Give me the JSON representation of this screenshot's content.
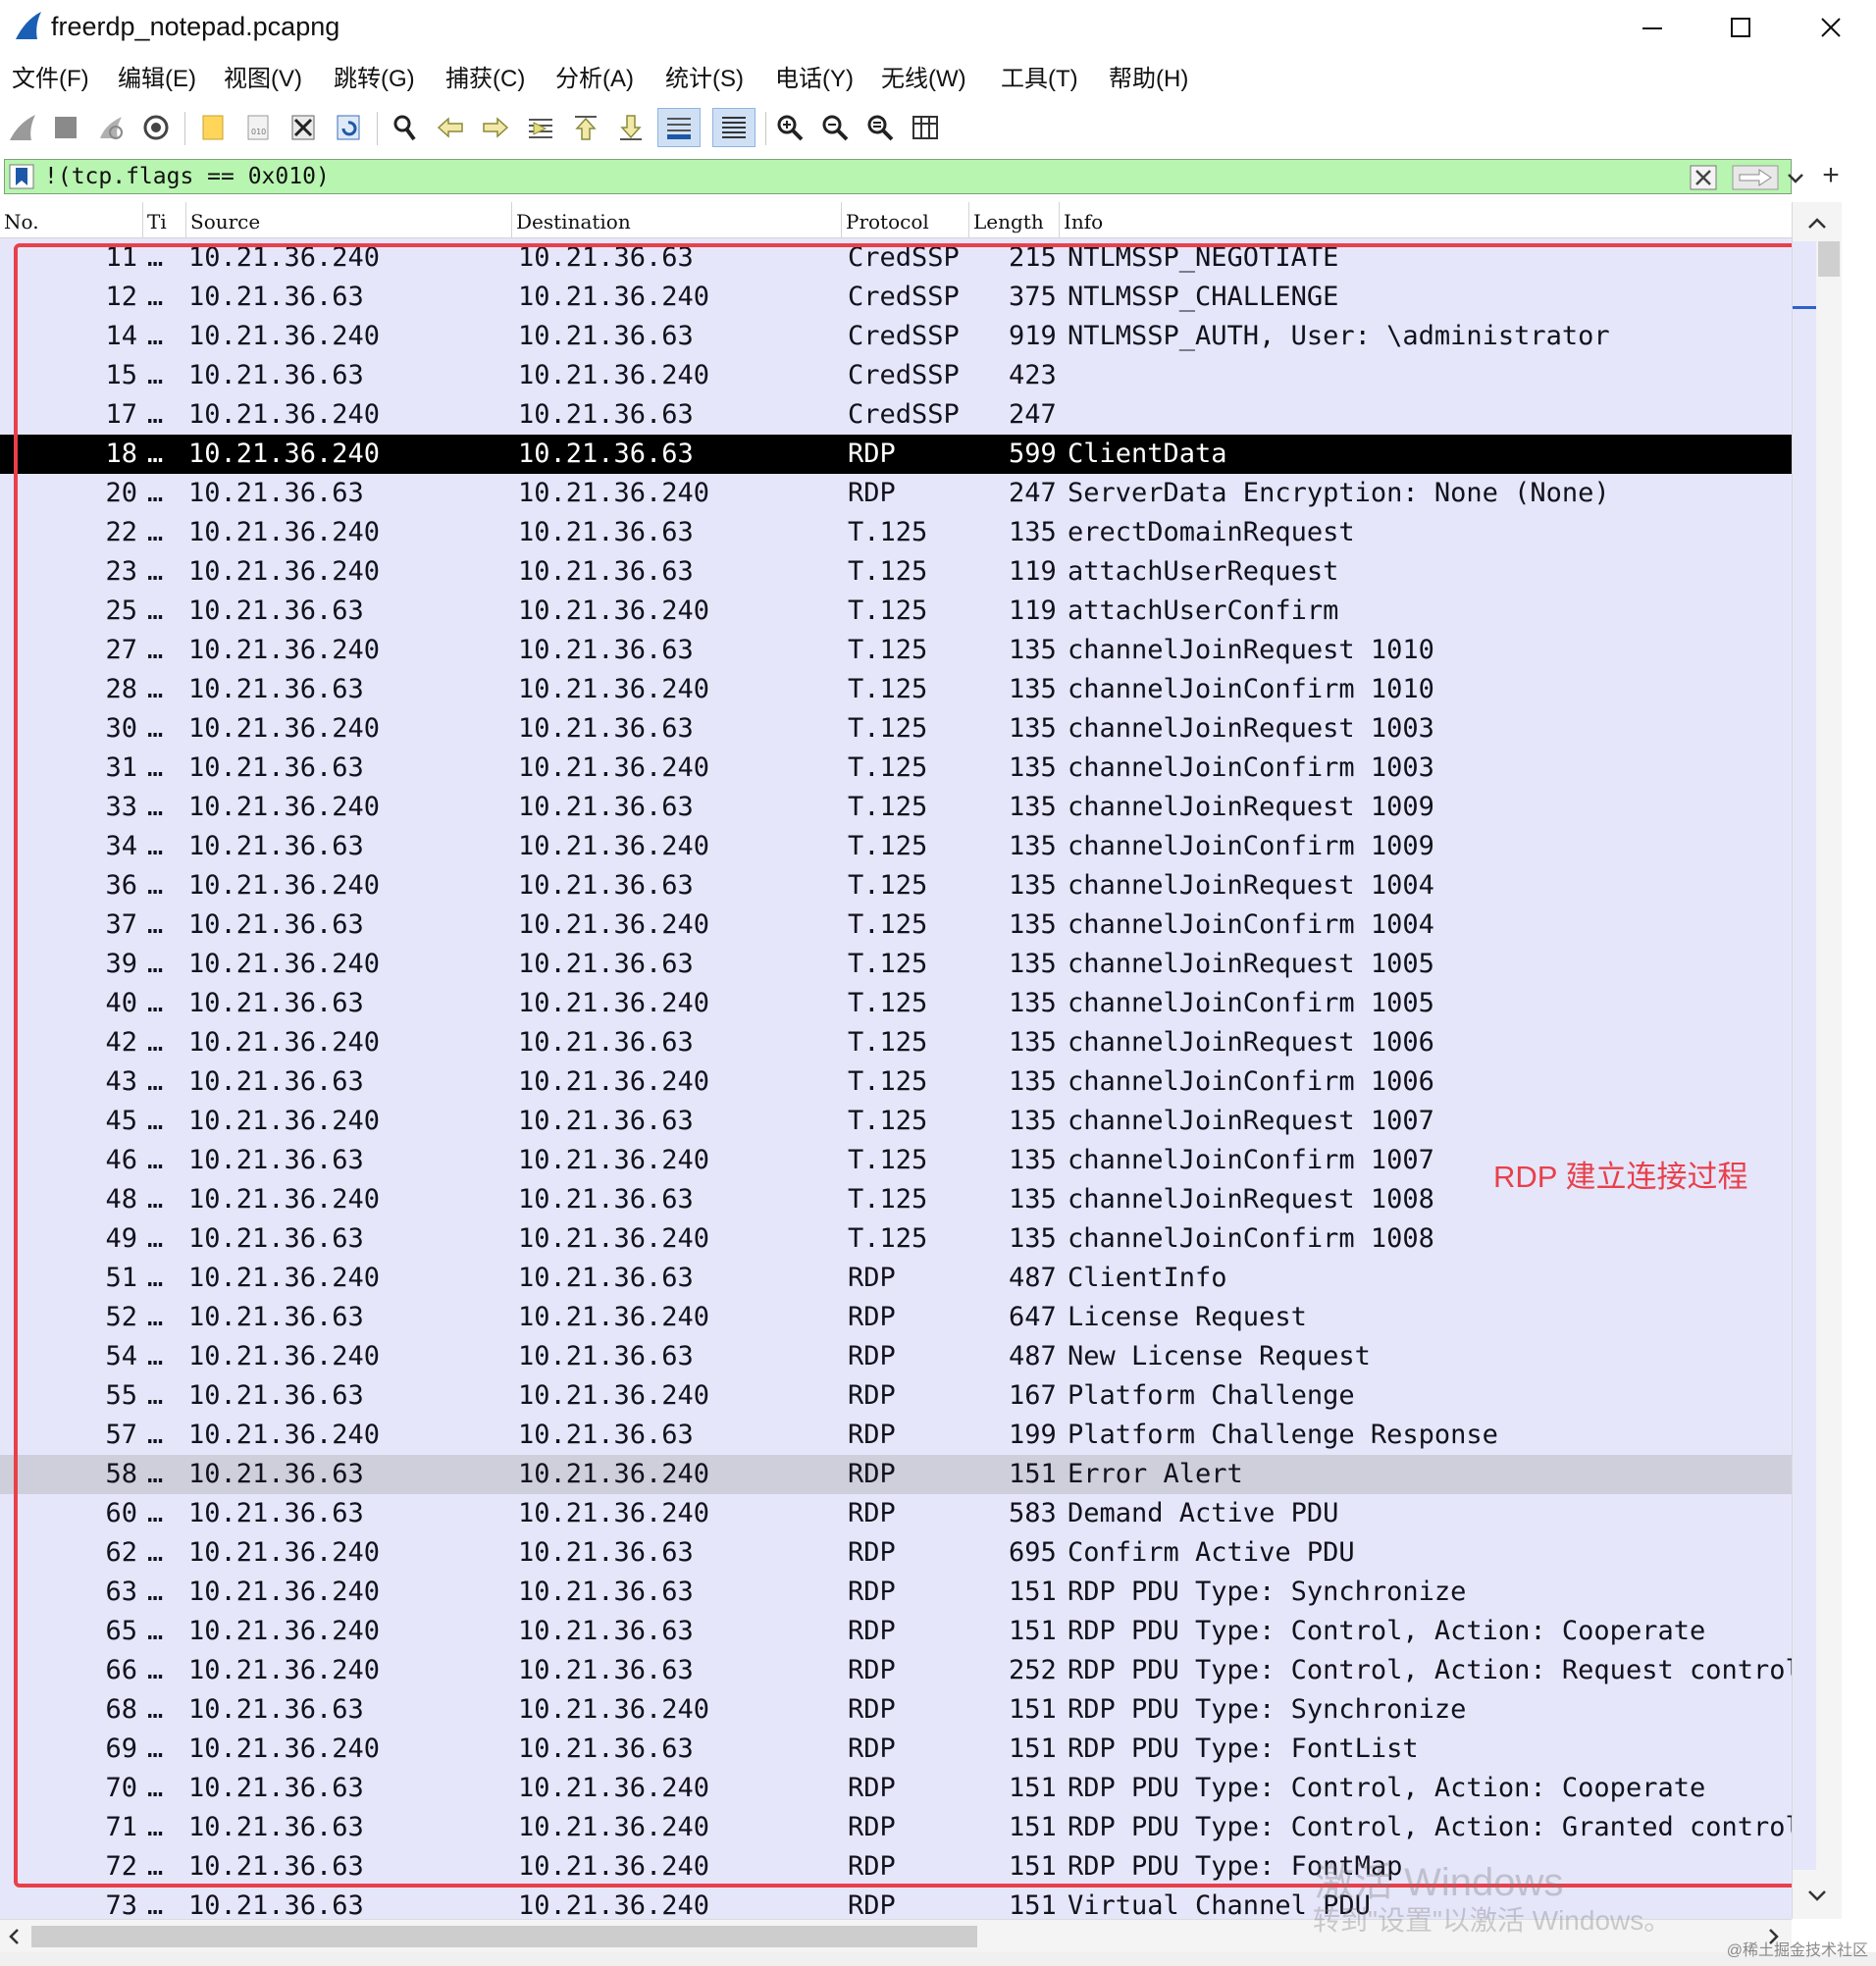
{
  "window": {
    "title": "freerdp_notepad.pcapng",
    "minimize": "—",
    "maximize": "☐",
    "close": "✕"
  },
  "menu": [
    {
      "label": "文件(F)"
    },
    {
      "label": "编辑(E)"
    },
    {
      "label": "视图(V)"
    },
    {
      "label": "跳转(G)"
    },
    {
      "label": "捕获(C)"
    },
    {
      "label": "分析(A)"
    },
    {
      "label": "统计(S)"
    },
    {
      "label": "电话(Y)"
    },
    {
      "label": "无线(W)"
    },
    {
      "label": "工具(T)"
    },
    {
      "label": "帮助(H)"
    }
  ],
  "toolbar": {
    "icons": [
      "start-capture-icon",
      "stop-capture-icon",
      "restart-capture-icon",
      "capture-options-icon",
      "open-file-icon",
      "save-file-icon",
      "close-file-icon",
      "reload-file-icon",
      "find-packet-icon",
      "go-back-icon",
      "go-forward-icon",
      "go-to-packet-icon",
      "go-first-icon",
      "go-last-icon",
      "autoscroll-icon",
      "colorize-icon",
      "zoom-in-icon",
      "zoom-out-icon",
      "zoom-normal-icon",
      "resize-columns-icon"
    ]
  },
  "filter": {
    "value": "!(tcp.flags == 0x010)",
    "bg_color": "#b8f5b0"
  },
  "columns": {
    "no": "No.",
    "time": "Ti",
    "source": "Source",
    "destination": "Destination",
    "protocol": "Protocol",
    "length": "Length",
    "info": "Info"
  },
  "packets": [
    {
      "no": "11",
      "time": "…",
      "src": "10.21.36.240",
      "dst": "10.21.36.63",
      "proto": "CredSSP",
      "len": "215",
      "info": "NTLMSSP_NEGOTIATE"
    },
    {
      "no": "12",
      "time": "…",
      "src": "10.21.36.63",
      "dst": "10.21.36.240",
      "proto": "CredSSP",
      "len": "375",
      "info": "NTLMSSP_CHALLENGE"
    },
    {
      "no": "14",
      "time": "…",
      "src": "10.21.36.240",
      "dst": "10.21.36.63",
      "proto": "CredSSP",
      "len": "919",
      "info": "NTLMSSP_AUTH, User: \\administrator"
    },
    {
      "no": "15",
      "time": "…",
      "src": "10.21.36.63",
      "dst": "10.21.36.240",
      "proto": "CredSSP",
      "len": "423",
      "info": ""
    },
    {
      "no": "17",
      "time": "…",
      "src": "10.21.36.240",
      "dst": "10.21.36.63",
      "proto": "CredSSP",
      "len": "247",
      "info": ""
    },
    {
      "no": "18",
      "time": "…",
      "src": "10.21.36.240",
      "dst": "10.21.36.63",
      "proto": "RDP",
      "len": "599",
      "info": "ClientData",
      "state": "selected"
    },
    {
      "no": "20",
      "time": "…",
      "src": "10.21.36.63",
      "dst": "10.21.36.240",
      "proto": "RDP",
      "len": "247",
      "info": "ServerData Encryption: None (None)"
    },
    {
      "no": "22",
      "time": "…",
      "src": "10.21.36.240",
      "dst": "10.21.36.63",
      "proto": "T.125",
      "len": "135",
      "info": "erectDomainRequest"
    },
    {
      "no": "23",
      "time": "…",
      "src": "10.21.36.240",
      "dst": "10.21.36.63",
      "proto": "T.125",
      "len": "119",
      "info": "attachUserRequest"
    },
    {
      "no": "25",
      "time": "…",
      "src": "10.21.36.63",
      "dst": "10.21.36.240",
      "proto": "T.125",
      "len": "119",
      "info": "attachUserConfirm"
    },
    {
      "no": "27",
      "time": "…",
      "src": "10.21.36.240",
      "dst": "10.21.36.63",
      "proto": "T.125",
      "len": "135",
      "info": "channelJoinRequest 1010"
    },
    {
      "no": "28",
      "time": "…",
      "src": "10.21.36.63",
      "dst": "10.21.36.240",
      "proto": "T.125",
      "len": "135",
      "info": "channelJoinConfirm 1010"
    },
    {
      "no": "30",
      "time": "…",
      "src": "10.21.36.240",
      "dst": "10.21.36.63",
      "proto": "T.125",
      "len": "135",
      "info": "channelJoinRequest 1003"
    },
    {
      "no": "31",
      "time": "…",
      "src": "10.21.36.63",
      "dst": "10.21.36.240",
      "proto": "T.125",
      "len": "135",
      "info": "channelJoinConfirm 1003"
    },
    {
      "no": "33",
      "time": "…",
      "src": "10.21.36.240",
      "dst": "10.21.36.63",
      "proto": "T.125",
      "len": "135",
      "info": "channelJoinRequest 1009"
    },
    {
      "no": "34",
      "time": "…",
      "src": "10.21.36.63",
      "dst": "10.21.36.240",
      "proto": "T.125",
      "len": "135",
      "info": "channelJoinConfirm 1009"
    },
    {
      "no": "36",
      "time": "…",
      "src": "10.21.36.240",
      "dst": "10.21.36.63",
      "proto": "T.125",
      "len": "135",
      "info": "channelJoinRequest 1004"
    },
    {
      "no": "37",
      "time": "…",
      "src": "10.21.36.63",
      "dst": "10.21.36.240",
      "proto": "T.125",
      "len": "135",
      "info": "channelJoinConfirm 1004"
    },
    {
      "no": "39",
      "time": "…",
      "src": "10.21.36.240",
      "dst": "10.21.36.63",
      "proto": "T.125",
      "len": "135",
      "info": "channelJoinRequest 1005"
    },
    {
      "no": "40",
      "time": "…",
      "src": "10.21.36.63",
      "dst": "10.21.36.240",
      "proto": "T.125",
      "len": "135",
      "info": "channelJoinConfirm 1005"
    },
    {
      "no": "42",
      "time": "…",
      "src": "10.21.36.240",
      "dst": "10.21.36.63",
      "proto": "T.125",
      "len": "135",
      "info": "channelJoinRequest 1006"
    },
    {
      "no": "43",
      "time": "…",
      "src": "10.21.36.63",
      "dst": "10.21.36.240",
      "proto": "T.125",
      "len": "135",
      "info": "channelJoinConfirm 1006"
    },
    {
      "no": "45",
      "time": "…",
      "src": "10.21.36.240",
      "dst": "10.21.36.63",
      "proto": "T.125",
      "len": "135",
      "info": "channelJoinRequest 1007"
    },
    {
      "no": "46",
      "time": "…",
      "src": "10.21.36.63",
      "dst": "10.21.36.240",
      "proto": "T.125",
      "len": "135",
      "info": "channelJoinConfirm 1007"
    },
    {
      "no": "48",
      "time": "…",
      "src": "10.21.36.240",
      "dst": "10.21.36.63",
      "proto": "T.125",
      "len": "135",
      "info": "channelJoinRequest 1008"
    },
    {
      "no": "49",
      "time": "…",
      "src": "10.21.36.63",
      "dst": "10.21.36.240",
      "proto": "T.125",
      "len": "135",
      "info": "channelJoinConfirm 1008"
    },
    {
      "no": "51",
      "time": "…",
      "src": "10.21.36.240",
      "dst": "10.21.36.63",
      "proto": "RDP",
      "len": "487",
      "info": "ClientInfo"
    },
    {
      "no": "52",
      "time": "…",
      "src": "10.21.36.63",
      "dst": "10.21.36.240",
      "proto": "RDP",
      "len": "647",
      "info": "License Request"
    },
    {
      "no": "54",
      "time": "…",
      "src": "10.21.36.240",
      "dst": "10.21.36.63",
      "proto": "RDP",
      "len": "487",
      "info": "New License Request"
    },
    {
      "no": "55",
      "time": "…",
      "src": "10.21.36.63",
      "dst": "10.21.36.240",
      "proto": "RDP",
      "len": "167",
      "info": "Platform Challenge"
    },
    {
      "no": "57",
      "time": "…",
      "src": "10.21.36.240",
      "dst": "10.21.36.63",
      "proto": "RDP",
      "len": "199",
      "info": "Platform Challenge Response"
    },
    {
      "no": "58",
      "time": "…",
      "src": "10.21.36.63",
      "dst": "10.21.36.240",
      "proto": "RDP",
      "len": "151",
      "info": "Error Alert",
      "state": "hover"
    },
    {
      "no": "60",
      "time": "…",
      "src": "10.21.36.63",
      "dst": "10.21.36.240",
      "proto": "RDP",
      "len": "583",
      "info": "Demand Active PDU"
    },
    {
      "no": "62",
      "time": "…",
      "src": "10.21.36.240",
      "dst": "10.21.36.63",
      "proto": "RDP",
      "len": "695",
      "info": "Confirm Active PDU"
    },
    {
      "no": "63",
      "time": "…",
      "src": "10.21.36.240",
      "dst": "10.21.36.63",
      "proto": "RDP",
      "len": "151",
      "info": "RDP PDU Type: Synchronize"
    },
    {
      "no": "65",
      "time": "…",
      "src": "10.21.36.240",
      "dst": "10.21.36.63",
      "proto": "RDP",
      "len": "151",
      "info": "RDP PDU Type: Control, Action: Cooperate"
    },
    {
      "no": "66",
      "time": "…",
      "src": "10.21.36.240",
      "dst": "10.21.36.63",
      "proto": "RDP",
      "len": "252",
      "info": "RDP PDU Type: Control, Action: Request control"
    },
    {
      "no": "68",
      "time": "…",
      "src": "10.21.36.63",
      "dst": "10.21.36.240",
      "proto": "RDP",
      "len": "151",
      "info": "RDP PDU Type: Synchronize"
    },
    {
      "no": "69",
      "time": "…",
      "src": "10.21.36.240",
      "dst": "10.21.36.63",
      "proto": "RDP",
      "len": "151",
      "info": "RDP PDU Type: FontList"
    },
    {
      "no": "70",
      "time": "…",
      "src": "10.21.36.63",
      "dst": "10.21.36.240",
      "proto": "RDP",
      "len": "151",
      "info": "RDP PDU Type: Control, Action: Cooperate"
    },
    {
      "no": "71",
      "time": "…",
      "src": "10.21.36.63",
      "dst": "10.21.36.240",
      "proto": "RDP",
      "len": "151",
      "info": "RDP PDU Type: Control, Action: Granted control"
    },
    {
      "no": "72",
      "time": "…",
      "src": "10.21.36.63",
      "dst": "10.21.36.240",
      "proto": "RDP",
      "len": "151",
      "info": "RDP PDU Type: FontMap"
    },
    {
      "no": "73",
      "time": "…",
      "src": "10.21.36.63",
      "dst": "10.21.36.240",
      "proto": "RDP",
      "len": "151",
      "info": "Virtual Channel PDU"
    }
  ],
  "annotation": {
    "text": "RDP 建立连接过程",
    "color": "#e8404a"
  },
  "watermark": {
    "line1": "激活 Windows",
    "line2": "转到\"设置\"以激活 Windows。",
    "credit": "@稀土掘金技术社区"
  },
  "colors": {
    "row_bg": "#e6e6fb",
    "selected_bg": "#000000",
    "hover_bg": "#cfcfdc"
  }
}
